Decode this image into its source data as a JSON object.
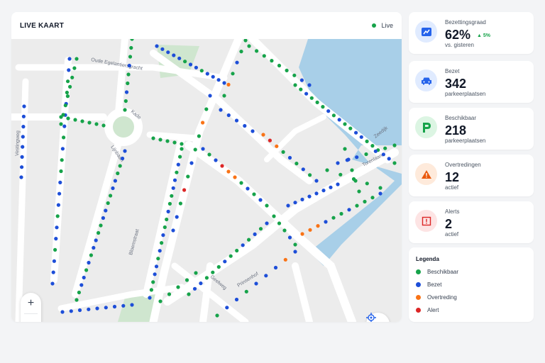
{
  "map": {
    "title": "LIVE KAART",
    "live_label": "Live",
    "streets": [
      "Oude Egelantiersgracht",
      "Zeedijk",
      "Kade",
      "Vestingweg",
      "Lijnbaan",
      "Torenlaan",
      "Geelweg",
      "Bloemstraat",
      "Prinsenhof"
    ],
    "zoom_in_label": "+",
    "zoom_out_label": "−"
  },
  "stats": [
    {
      "label": "Bezettingsgraad",
      "value": "62%",
      "trend": "5%",
      "sub": "vs. gisteren",
      "icon": "trend-chart-icon",
      "color": "#2563eb"
    },
    {
      "label": "Bezet",
      "value": "342",
      "sub": "parkeerplaatsen",
      "icon": "car-icon",
      "color": "#2563eb"
    },
    {
      "label": "Beschikbaar",
      "value": "218",
      "sub": "parkeerplaatsen",
      "icon": "parking-icon",
      "color": "#16a34a"
    },
    {
      "label": "Overtredingen",
      "value": "12",
      "sub": "actief",
      "icon": "warning-icon",
      "color": "#ea580c"
    },
    {
      "label": "Alerts",
      "value": "2",
      "sub": "actief",
      "icon": "alert-icon",
      "color": "#dc2626"
    }
  ],
  "legend": {
    "title": "Legenda",
    "items": [
      {
        "label": "Beschikbaar",
        "color": "#16a34a"
      },
      {
        "label": "Bezet",
        "color": "#1d4ed8"
      },
      {
        "label": "Overtreding",
        "color": "#f97316"
      },
      {
        "label": "Alert",
        "color": "#dc2626"
      }
    ]
  },
  "colors": {
    "water": "#a8cfe8",
    "park": "#cfe6cf",
    "road": "#ffffff",
    "block": "#ececec"
  }
}
